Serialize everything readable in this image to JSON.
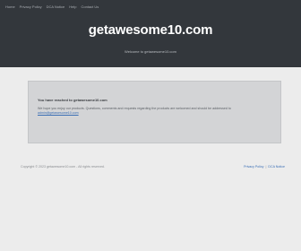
{
  "nav": {
    "items": [
      "Home",
      "Privacy Policy",
      "DCA Notice",
      "Help",
      "Contact Us"
    ]
  },
  "hero": {
    "brand": "getawesome10.com",
    "tagline": "Welcome to getawesome10.com"
  },
  "notice": {
    "heading": "You have reached to getawesome10.com",
    "body": "We hope you enjoy our products. Questions, comments and requests regarding the products are welcomed and should be addressed to",
    "email": "admin@getawesome10.com"
  },
  "footer": {
    "copyright": "Copyright © 2023 getawesome10.com - All rights reserved.",
    "links": [
      "Privacy Policy",
      "DCA Notice"
    ],
    "separator": "|"
  }
}
